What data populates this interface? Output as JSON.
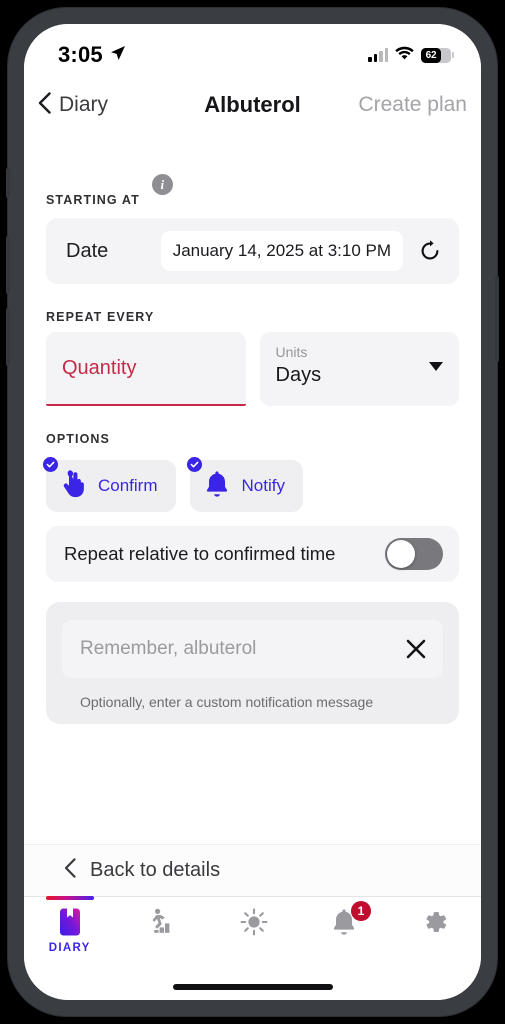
{
  "status_bar": {
    "time": "3:05",
    "location_icon": "location-arrow-icon",
    "signal_icon": "cellular-signal-icon",
    "wifi_icon": "wifi-icon",
    "battery_percent": "62"
  },
  "header": {
    "back_label": "Diary",
    "back_icon": "chevron-left-icon",
    "title": "Albuterol",
    "action_label": "Create plan"
  },
  "starting_at": {
    "section_label": "STARTING AT",
    "info_icon": "info-icon",
    "info_glyph": "i",
    "row_label": "Date",
    "date_value": "January 14, 2025 at 3:10 PM",
    "reset_icon": "reset-refresh-icon"
  },
  "repeat_every": {
    "section_label": "REPEAT EVERY",
    "quantity_placeholder": "Quantity",
    "quantity_value": "",
    "units_label": "Units",
    "units_value": "Days",
    "units_caret_icon": "chevron-down-icon",
    "error_color": "#c62a48"
  },
  "options": {
    "section_label": "OPTIONS",
    "accent_color": "#3a25e6",
    "chips": [
      {
        "label": "Confirm",
        "icon": "tap-hand-icon",
        "selected": true,
        "check_icon": "check-badge-icon"
      },
      {
        "label": "Notify",
        "icon": "bell-icon",
        "selected": true,
        "check_icon": "check-badge-icon"
      }
    ],
    "toggle_label": "Repeat relative to confirmed time",
    "toggle_state": "off"
  },
  "notification_message": {
    "placeholder": "Remember, albuterol",
    "value": "",
    "clear_icon": "close-x-icon",
    "helper_text": "Optionally, enter a custom notification message"
  },
  "footer": {
    "back_to_details_label": "Back to details",
    "back_icon": "chevron-left-icon"
  },
  "tab_bar": {
    "active_index": 0,
    "active_color": "#3a25e6",
    "inactive_color": "#9a9a9f",
    "badge_color": "#bf0d2e",
    "items": [
      {
        "label": "DIARY",
        "icon": "diary-book-icon",
        "badge": ""
      },
      {
        "label": "",
        "icon": "activity-steps-icon",
        "badge": ""
      },
      {
        "label": "",
        "icon": "weather-sun-icon",
        "badge": ""
      },
      {
        "label": "",
        "icon": "bell-icon",
        "badge": "1"
      },
      {
        "label": "",
        "icon": "gear-icon",
        "badge": ""
      }
    ]
  }
}
